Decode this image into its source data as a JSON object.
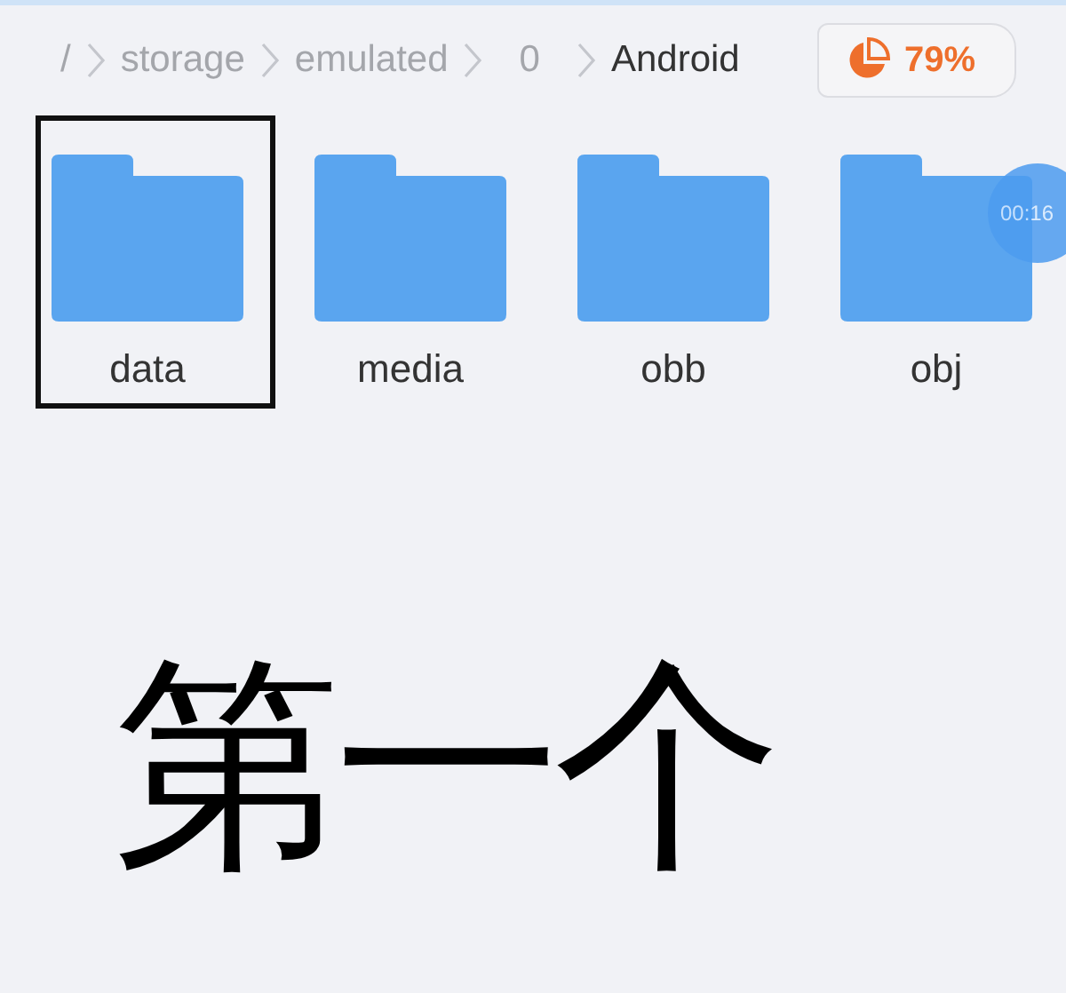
{
  "breadcrumb": [
    {
      "label": "/",
      "selected": false
    },
    {
      "label": "storage",
      "selected": false
    },
    {
      "label": "emulated",
      "selected": false
    },
    {
      "label": "0",
      "selected": false
    },
    {
      "label": "Android",
      "selected": true
    }
  ],
  "storage_badge": {
    "percent": "79%"
  },
  "folders": [
    {
      "name": "data",
      "highlighted": true
    },
    {
      "name": "media",
      "highlighted": false
    },
    {
      "name": "obb",
      "highlighted": false
    },
    {
      "name": "obj",
      "highlighted": false
    }
  ],
  "timer_bubble": {
    "time": "00:16"
  },
  "caption": "第一个"
}
